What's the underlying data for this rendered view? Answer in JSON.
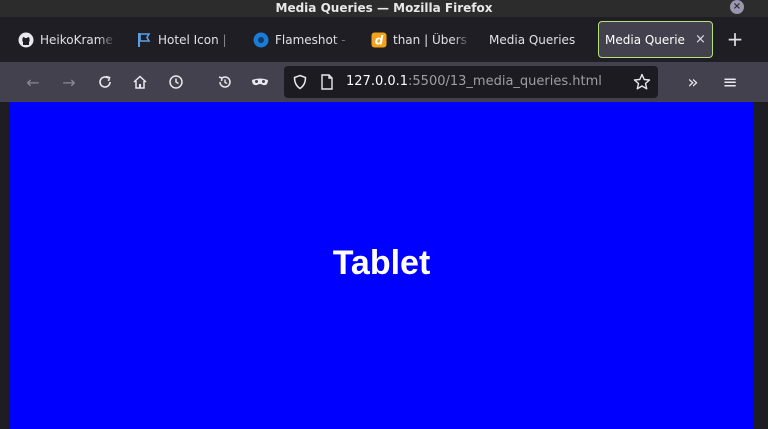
{
  "window": {
    "title": "Media Queries — Mozilla Firefox",
    "close_symbol": "×"
  },
  "tabs": [
    {
      "label": "HeikoKrame",
      "icon": "github-icon"
    },
    {
      "label": "Hotel Icon | ",
      "icon": "flag-icon"
    },
    {
      "label": "Flameshot - ",
      "icon": "flameshot-icon"
    },
    {
      "label": "than | Übers",
      "icon": "dict-icon"
    },
    {
      "label": "Media Queries",
      "icon": ""
    },
    {
      "label": "Media Querie",
      "icon": "",
      "active": true,
      "close": "×"
    }
  ],
  "new_tab_symbol": "+",
  "toolbar": {
    "back": "←",
    "forward": "→",
    "reload": "↻",
    "home": "⌂",
    "history": "◷",
    "overflow": "»",
    "menu": "≡"
  },
  "url": {
    "host": "127.0.0.1",
    "rest": ":5500/13_media_queries.html"
  },
  "page": {
    "heading": "Tablet",
    "background": "#0000ff"
  }
}
